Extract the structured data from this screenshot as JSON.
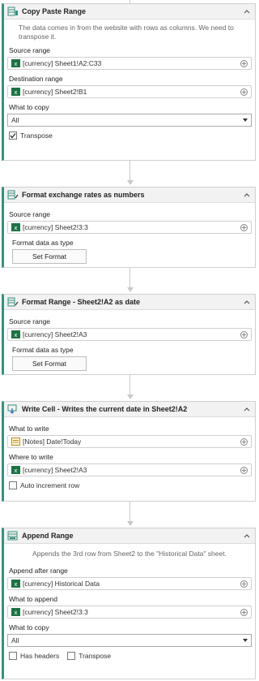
{
  "cards": [
    {
      "title": "Copy Paste Range",
      "description": "The data comes in from the website with rows as columns. We need to transpose it.",
      "source_label": "Source range",
      "source_value": "[currency] Sheet1!A2:C33",
      "dest_label": "Destination range",
      "dest_value": "[currency] Sheet2!B1",
      "copy_label": "What to copy",
      "copy_value": "All",
      "transpose_label": "Transpose",
      "transpose_checked": true
    },
    {
      "title": "Format exchange rates as numbers",
      "source_label": "Source range",
      "source_value": "[currency] Sheet2!3:3",
      "format_label": "Format data as type",
      "button_label": "Set Format"
    },
    {
      "title": "Format Range - Sheet2!A2 as date",
      "source_label": "Source range",
      "source_value": "[currency] Sheet2!A3",
      "format_label": "Format data as type",
      "button_label": "Set Format"
    },
    {
      "title": "Write Cell - Writes the current date in Sheet2!A2",
      "what_label": "What to write",
      "what_value": "[Notes] Date!Today",
      "where_label": "Where to write",
      "where_value": "[currency] Sheet2!A3",
      "auto_label": "Auto increment row",
      "auto_checked": false
    },
    {
      "title": "Append Range",
      "description": "Appends the 3rd row from Sheet2 to the \"Historical Data\" sheet.",
      "after_label": "Append after range",
      "after_value": "[currency] Historical Data",
      "append_label": "What to append",
      "append_value": "[currency] Sheet2!3:3",
      "copy_label": "What to copy",
      "copy_value": "All",
      "headers_label": "Has headers",
      "transpose_label": "Transpose"
    }
  ],
  "colors": {
    "accent": "#3a8f7e",
    "excel_green": "#1e7145"
  },
  "icons": [
    "range-icon",
    "format-icon",
    "write-cell-icon",
    "append-icon",
    "excel-icon",
    "notes-icon",
    "add-variable-icon",
    "chevron-up-icon",
    "checkmark-icon",
    "dropdown-caret-icon"
  ]
}
